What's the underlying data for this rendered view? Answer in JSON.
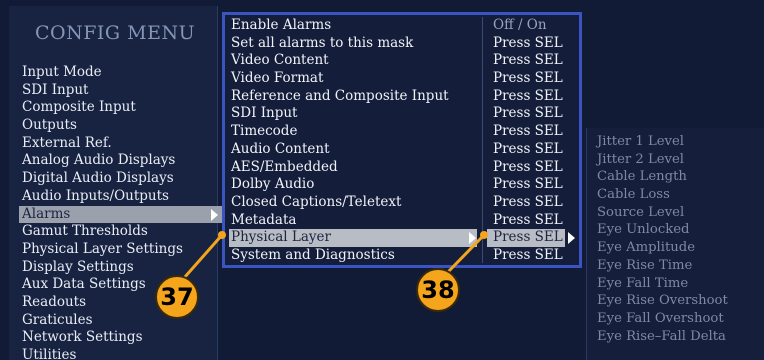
{
  "config_menu": {
    "title": "CONFIG MENU",
    "items": [
      "Input Mode",
      "SDI Input",
      "Composite Input",
      "Outputs",
      "External Ref.",
      "Analog Audio Displays",
      "Digital Audio Displays",
      "Audio Inputs/Outputs",
      "Alarms",
      "Gamut Thresholds",
      "Physical Layer Settings",
      "Display Settings",
      "Aux Data Settings",
      "Readouts",
      "Graticules",
      "Network Settings",
      "Utilities"
    ],
    "selected": "Alarms"
  },
  "alarms_menu": {
    "items": [
      {
        "label": "Enable Alarms",
        "value": "Off / On"
      },
      {
        "label": "Set all alarms to this mask",
        "value": "Press SEL"
      },
      {
        "label": "Video Content",
        "value": "Press SEL"
      },
      {
        "label": "Video Format",
        "value": "Press SEL"
      },
      {
        "label": "Reference and Composite Input",
        "value": "Press SEL"
      },
      {
        "label": "SDI Input",
        "value": "Press SEL"
      },
      {
        "label": "Timecode",
        "value": "Press SEL"
      },
      {
        "label": "Audio Content",
        "value": "Press SEL"
      },
      {
        "label": "AES/Embedded",
        "value": "Press SEL"
      },
      {
        "label": "Dolby Audio",
        "value": "Press SEL"
      },
      {
        "label": "Closed Captions/Teletext",
        "value": "Press SEL"
      },
      {
        "label": "Metadata",
        "value": "Press SEL"
      },
      {
        "label": "Physical Layer",
        "value": "Press SEL"
      },
      {
        "label": "System and Diagnostics",
        "value": "Press SEL"
      }
    ],
    "selected": "Physical Layer"
  },
  "physical_layer_menu": {
    "items": [
      "Jitter 1 Level",
      "Jitter 2 Level",
      "Cable Length",
      "Cable Loss",
      "Source Level",
      "Eye Unlocked",
      "Eye Amplitude",
      "Eye Rise Time",
      "Eye Fall Time",
      "Eye Rise Overshoot",
      "Eye Fall Overshoot",
      "Eye Rise–Fall Delta"
    ]
  },
  "callouts": {
    "left": "37",
    "right": "38",
    "color": "#f4a51c"
  },
  "colors": {
    "background": "#121b36",
    "highlight": "#b8bcc5",
    "panel_border": "#3a55c2"
  }
}
